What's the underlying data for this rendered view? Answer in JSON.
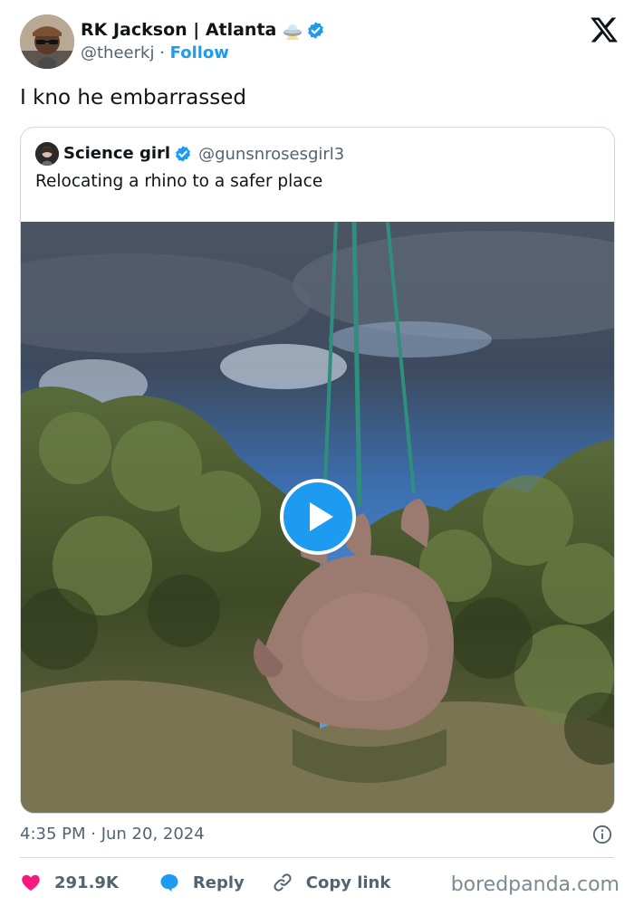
{
  "tweet": {
    "author_name": "RK Jackson | Atlanta",
    "handle": "@theerkj",
    "separator": "·",
    "follow_label": "Follow",
    "text": "I kno he embarrassed",
    "timestamp": "4:35 PM · Jun 20, 2024"
  },
  "quote": {
    "author_name": "Science girl",
    "handle": "@gunsnrosesgirl3",
    "text": "Relocating a rhino to a safer place"
  },
  "actions": {
    "likes": "291.9K",
    "reply_label": "Reply",
    "copy_label": "Copy link"
  },
  "watermark": "boredpanda.com",
  "icons": {
    "brand": "x-logo-icon",
    "verified": "verified-badge-icon",
    "emoji": "ufo-emoji-icon",
    "play": "play-icon",
    "info": "info-icon",
    "like": "heart-icon",
    "reply": "reply-bubble-icon",
    "copy": "link-icon"
  },
  "colors": {
    "accent": "#1d9bf0",
    "like": "#f91880",
    "text": "#0f1419",
    "muted": "#536471",
    "border": "#cfd9de"
  }
}
